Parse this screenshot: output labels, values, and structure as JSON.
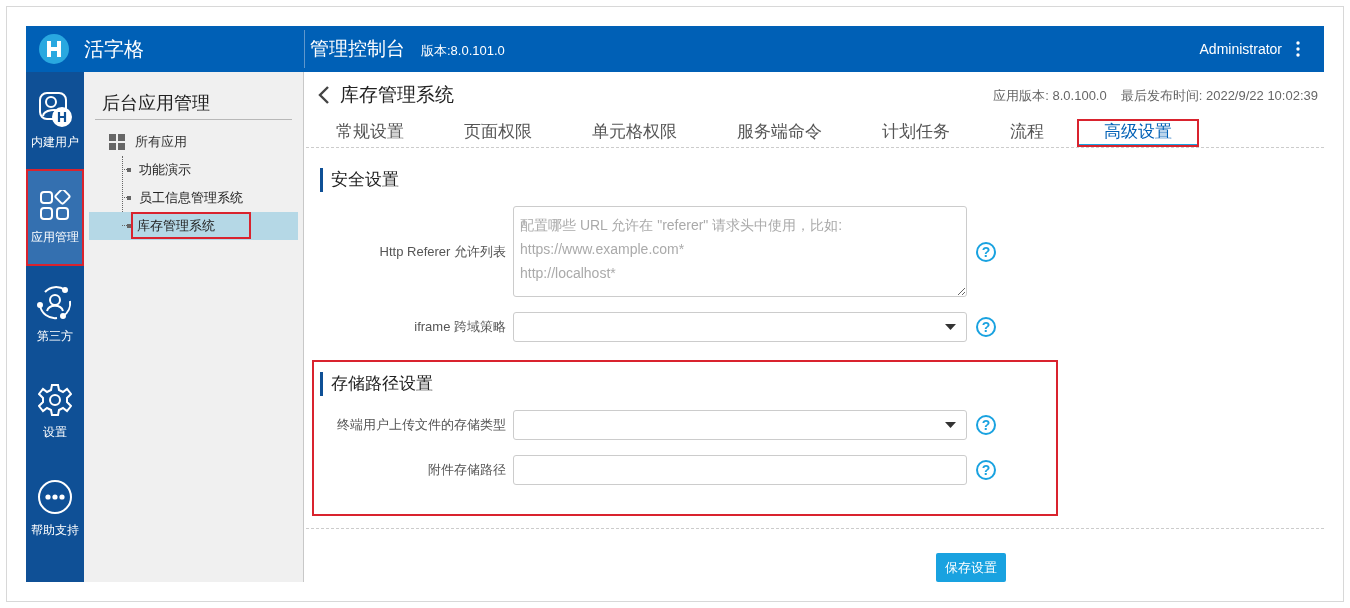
{
  "header": {
    "logo_text": "活字格",
    "title": "管理控制台",
    "version": "版本:8.0.101.0",
    "user": "Administrator"
  },
  "nav": [
    {
      "label": "内建用户",
      "kind": "user",
      "selected": false,
      "highlighted": false
    },
    {
      "label": "应用管理",
      "kind": "apps",
      "selected": true,
      "highlighted": true
    },
    {
      "label": "第三方",
      "kind": "third",
      "selected": false,
      "highlighted": false
    },
    {
      "label": "设置",
      "kind": "gear",
      "selected": false,
      "highlighted": false
    },
    {
      "label": "帮助支持",
      "kind": "more",
      "selected": false,
      "highlighted": false
    }
  ],
  "sidebar": {
    "title": "后台应用管理",
    "root": {
      "label": "所有应用",
      "children": [
        {
          "label": "功能演示",
          "selected": false,
          "highlighted": false
        },
        {
          "label": "员工信息管理系统",
          "selected": false,
          "highlighted": false
        },
        {
          "label": "库存管理系统",
          "selected": true,
          "highlighted": true
        }
      ]
    }
  },
  "page": {
    "title": "库存管理系统",
    "app_version": "应用版本: 8.0.100.0",
    "publish_time": "最后发布时间: 2022/9/22 10:02:39"
  },
  "tabs": [
    {
      "label": "常规设置",
      "selected": false,
      "highlighted": false
    },
    {
      "label": "页面权限",
      "selected": false,
      "highlighted": false
    },
    {
      "label": "单元格权限",
      "selected": false,
      "highlighted": false
    },
    {
      "label": "服务端命令",
      "selected": false,
      "highlighted": false
    },
    {
      "label": "计划任务",
      "selected": false,
      "highlighted": false
    },
    {
      "label": "流程",
      "selected": false,
      "highlighted": false
    },
    {
      "label": "高级设置",
      "selected": true,
      "highlighted": true
    }
  ],
  "sections": [
    {
      "title": "安全设置",
      "highlighted": false,
      "fields": [
        {
          "kind": "textarea",
          "label": "Http Referer 允许列表",
          "placeholder": "配置哪些 URL 允许在 \"referer\" 请求头中使用，比如:\nhttps://www.example.com*\nhttp://localhost*",
          "help": "?"
        },
        {
          "kind": "select",
          "label": "iframe 跨域策略",
          "help": "?"
        }
      ]
    },
    {
      "title": "存储路径设置",
      "highlighted": true,
      "fields": [
        {
          "kind": "select",
          "label": "终端用户上传文件的存储类型",
          "help": "?"
        },
        {
          "kind": "text",
          "label": "附件存储路径",
          "help": "?"
        }
      ]
    }
  ],
  "save_button": "保存设置"
}
